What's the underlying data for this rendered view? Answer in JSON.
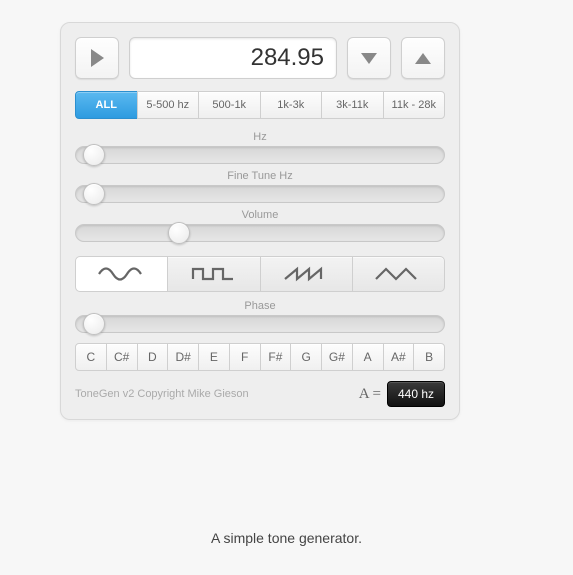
{
  "frequency_display": "284.95",
  "bands": [
    {
      "label": "ALL",
      "active": true
    },
    {
      "label": "5-500 hz",
      "active": false
    },
    {
      "label": "500-1k",
      "active": false
    },
    {
      "label": "1k-3k",
      "active": false
    },
    {
      "label": "3k-11k",
      "active": false
    },
    {
      "label": "11k - 28k",
      "active": false
    }
  ],
  "sliders": {
    "hz": {
      "label": "Hz",
      "position_pct": 5
    },
    "finetune": {
      "label": "Fine Tune Hz",
      "position_pct": 5
    },
    "volume": {
      "label": "Volume",
      "position_pct": 28
    },
    "phase": {
      "label": "Phase",
      "position_pct": 5
    }
  },
  "waveforms": [
    {
      "name": "sine",
      "active": true
    },
    {
      "name": "square",
      "active": false
    },
    {
      "name": "sawtooth",
      "active": false
    },
    {
      "name": "triangle",
      "active": false
    }
  ],
  "notes": [
    "C",
    "C#",
    "D",
    "D#",
    "E",
    "F",
    "F#",
    "G",
    "G#",
    "A",
    "A#",
    "B"
  ],
  "copyright": "ToneGen v2 Copyright Mike Gieson",
  "a_equals": {
    "label": "A =",
    "value": "440 hz"
  },
  "caption": "A simple tone generator."
}
